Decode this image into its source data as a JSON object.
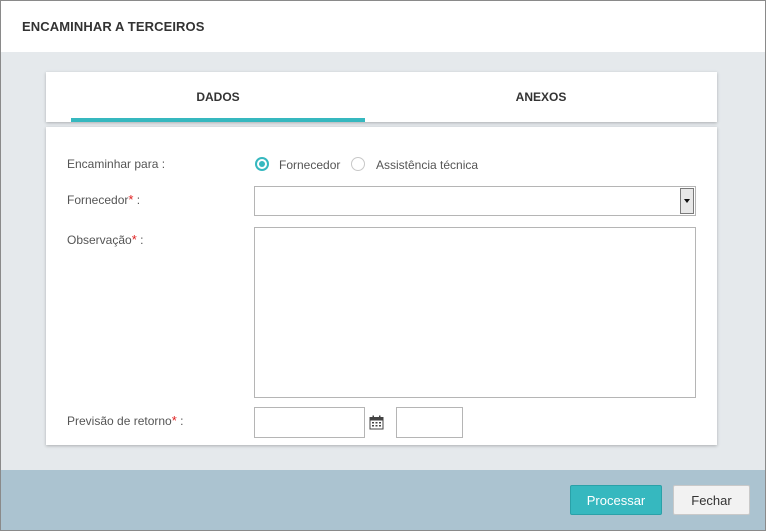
{
  "dialog": {
    "title": "ENCAMINHAR A TERCEIROS"
  },
  "tabs": [
    {
      "label": "DADOS",
      "active": true
    },
    {
      "label": "ANEXOS",
      "active": false
    }
  ],
  "form": {
    "encaminhar": {
      "label": "Encaminhar para :",
      "options": [
        {
          "label": "Fornecedor",
          "checked": true
        },
        {
          "label": "Assistência técnica",
          "checked": false
        }
      ]
    },
    "fornecedor": {
      "label": "Fornecedor",
      "required_mark": "*",
      "suffix": " :",
      "value": ""
    },
    "observacao": {
      "label": "Observação",
      "required_mark": "*",
      "suffix": " :",
      "value": ""
    },
    "previsao": {
      "label": "Previsão de retorno",
      "required_mark": "*",
      "suffix": " :",
      "date_value": "",
      "time_value": ""
    }
  },
  "footer": {
    "process_label": "Processar",
    "close_label": "Fechar"
  },
  "colors": {
    "accent": "#36b8bf",
    "required": "#e02020",
    "footer": "#abc3d0"
  }
}
